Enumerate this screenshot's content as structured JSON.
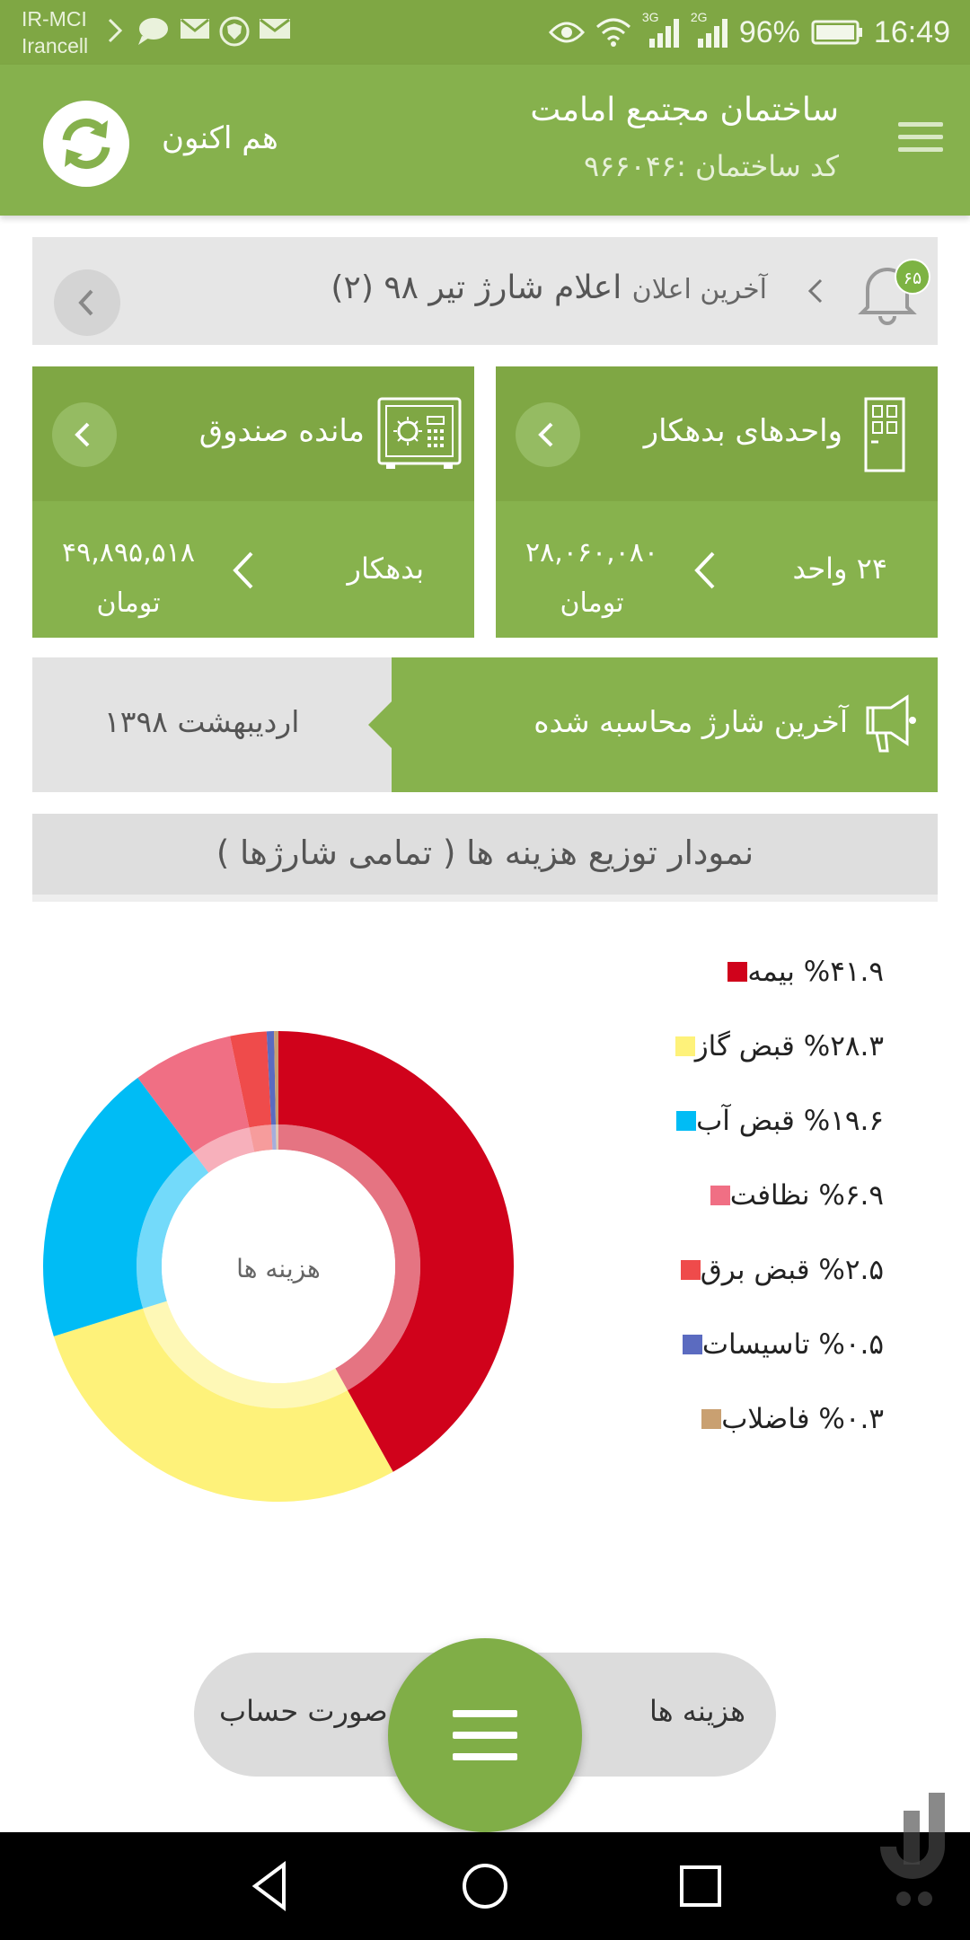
{
  "status_bar": {
    "carrier_1": "IR-MCI",
    "carrier_2": "Irancell",
    "network_1": "3G",
    "network_2": "2G",
    "battery": "96%",
    "time": "16:49"
  },
  "app_bar": {
    "building_name": "ساختمان مجتمع امامت",
    "building_code": "کد ساختمان :۹۶۶۰۴۶",
    "sync_label": "هم اکنون"
  },
  "announcement": {
    "label": "آخرین اعلان",
    "title": "اعلام شارژ تیر ۹۸ (۲)",
    "badge": "۶۵"
  },
  "debtor_units": {
    "title": "واحدهای بدهکار",
    "count": "۲۴ واحد",
    "amount": "۲۸,۰۶۰,۰۸۰",
    "currency": "تومان"
  },
  "fund_balance": {
    "title": "مانده صندوق",
    "status": "بدهکار",
    "amount": "۴۹,۸۹۵,۵۱۸",
    "currency": "تومان"
  },
  "last_charge": {
    "title": "آخرین شارژ محاسبه شده",
    "date": "اردیبهشت ۱۳۹۸"
  },
  "chart_section": {
    "header": "نمودار توزیع هزینه ها ( تمامی شارژها )"
  },
  "chart_data": {
    "type": "pie",
    "center_label": "هزینه ها",
    "labels": [
      "بیمه",
      "قبض گاز",
      "قبض آب",
      "نظافت",
      "قبض برق",
      "تاسیسات",
      "فاضلاب"
    ],
    "legend_text": [
      "%۴۱.۹ بیمه",
      "%۲۸.۳ قبض گاز",
      "%۱۹.۶ قبض آب",
      "%۶.۹ نظافت",
      "%۲.۵ قبض برق",
      "%۰.۵ تاسیسات",
      "%۰.۳ فاضلاب"
    ],
    "values": [
      41.9,
      28.3,
      19.6,
      6.9,
      2.5,
      0.5,
      0.3
    ],
    "colors": [
      "#d0021b",
      "#fef27a",
      "#00bcf5",
      "#f06f84",
      "#ef4b4b",
      "#5b6bc0",
      "#c9a071"
    ]
  },
  "bottom_bar": {
    "right_label": "هزینه ها",
    "left_label": "صورت حساب"
  }
}
